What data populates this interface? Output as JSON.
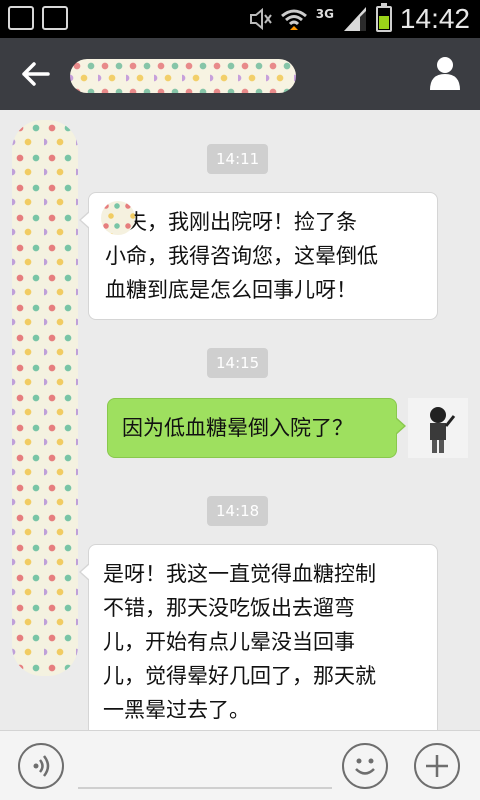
{
  "status_bar": {
    "network": "3G",
    "time": "14:42"
  },
  "header": {
    "title": "",
    "back_icon": "arrow-left-icon",
    "profile_icon": "person-icon"
  },
  "messages": [
    {
      "type": "time",
      "text": "14:11"
    },
    {
      "type": "incoming",
      "lines": [
        "大夫，我刚出院呀！捡了条",
        "小命，我得咨询您，这晕倒低",
        "血糖到底是怎么回事儿呀！"
      ]
    },
    {
      "type": "time",
      "text": "14:15"
    },
    {
      "type": "outgoing",
      "lines": [
        "因为低血糖晕倒入院了？"
      ]
    },
    {
      "type": "time",
      "text": "14:18"
    },
    {
      "type": "incoming",
      "lines": [
        "是呀！我这一直觉得血糖控制",
        "不错，那天没吃饭出去遛弯",
        "儿，开始有点儿晕没当回事",
        "儿，觉得晕好几回了，那天就",
        "一黑晕过去了。"
      ]
    }
  ],
  "input_bar": {
    "voice_icon": "voice-icon",
    "emoji_icon": "emoji-icon",
    "plus_icon": "plus-icon",
    "placeholder": ""
  },
  "colors": {
    "header_bg": "#3b3d42",
    "chat_bg": "#ebebeb",
    "outgoing_bubble": "#9ee05f",
    "incoming_bubble": "#ffffff",
    "battery_green": "#9bd319"
  }
}
